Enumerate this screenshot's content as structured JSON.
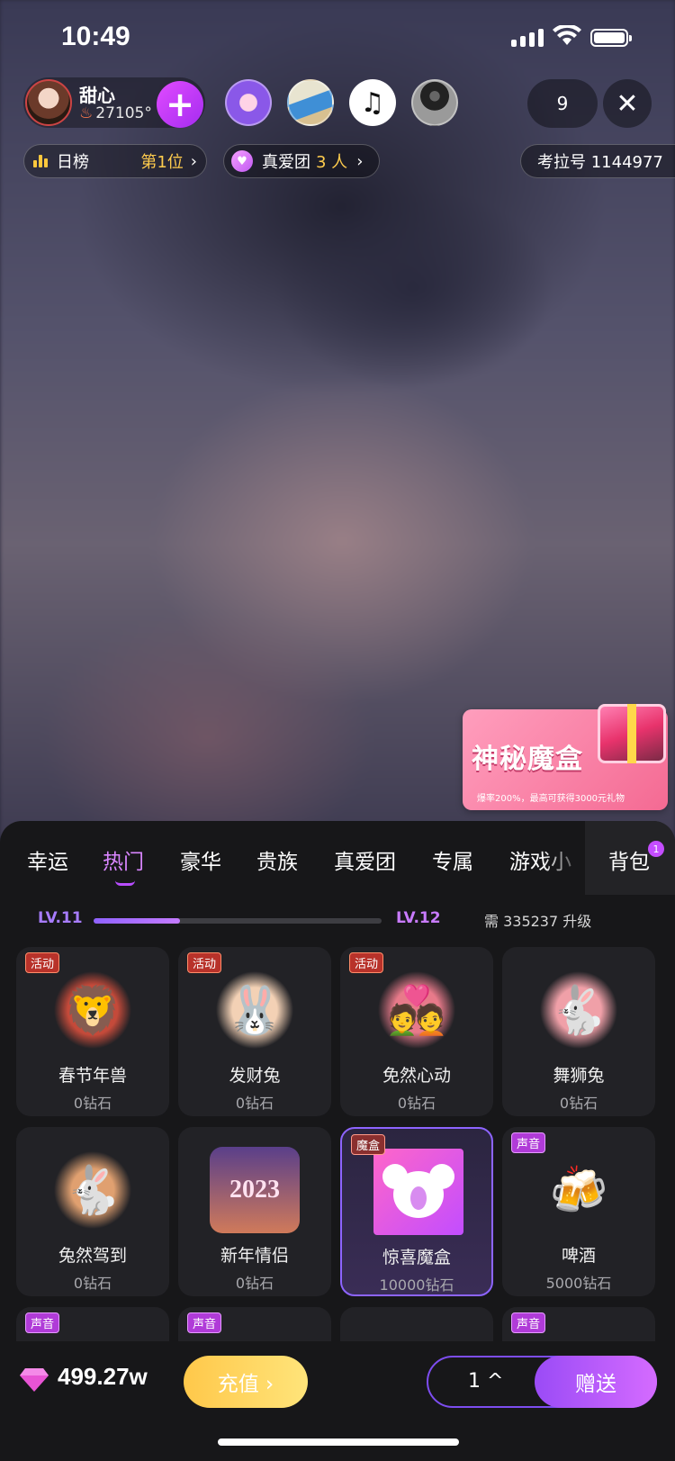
{
  "status_bar": {
    "time": "10:49"
  },
  "host": {
    "name": "甜心",
    "fans": "27105°"
  },
  "viewer_count": "9",
  "rank": {
    "label": "日榜",
    "value": "第1位"
  },
  "fan_club": {
    "label": "真爱团",
    "count": "3 人"
  },
  "room_id": "考拉号 1144977",
  "promo": {
    "title": "神秘魔盒",
    "subtitle": "爆率200%，最高可获得3000元礼物"
  },
  "tabs": [
    "幸运",
    "热门",
    "豪华",
    "贵族",
    "真爱团",
    "专属",
    "游戏小",
    "背包"
  ],
  "active_tab": "热门",
  "backpack_badge": "1",
  "level": {
    "current": "LV.11",
    "next": "LV.12",
    "need": "需 335237 升级",
    "progress": 0.3
  },
  "gifts": [
    {
      "name": "春节年兽",
      "price": "0钻石",
      "tag": "活动",
      "icon": "lion-icon"
    },
    {
      "name": "发财兔",
      "price": "0钻石",
      "tag": "活动",
      "icon": "rabbit-icon"
    },
    {
      "name": "免然心动",
      "price": "0钻石",
      "tag": "活动",
      "icon": "couple-icon"
    },
    {
      "name": "舞狮兔",
      "price": "0钻石",
      "tag": "",
      "icon": "lion-dance-icon"
    },
    {
      "name": "兔然驾到",
      "price": "0钻石",
      "tag": "",
      "icon": "rabbit-fairy-icon"
    },
    {
      "name": "新年情侣",
      "price": "0钻石",
      "tag": "",
      "icon": "new-year-icon"
    },
    {
      "name": "惊喜魔盒",
      "price": "10000钻石",
      "tag": "魔盒",
      "icon": "koala-box-icon"
    },
    {
      "name": "啤酒",
      "price": "5000钻石",
      "tag": "声音",
      "icon": "beer-icon"
    }
  ],
  "partial_row_tags": [
    "声音",
    "声音",
    "",
    "声音"
  ],
  "new_year_badge": "2023",
  "balance": "499.27w",
  "recharge_label": "充值 ›",
  "quantity": "1 ^",
  "send_label": "赠送"
}
